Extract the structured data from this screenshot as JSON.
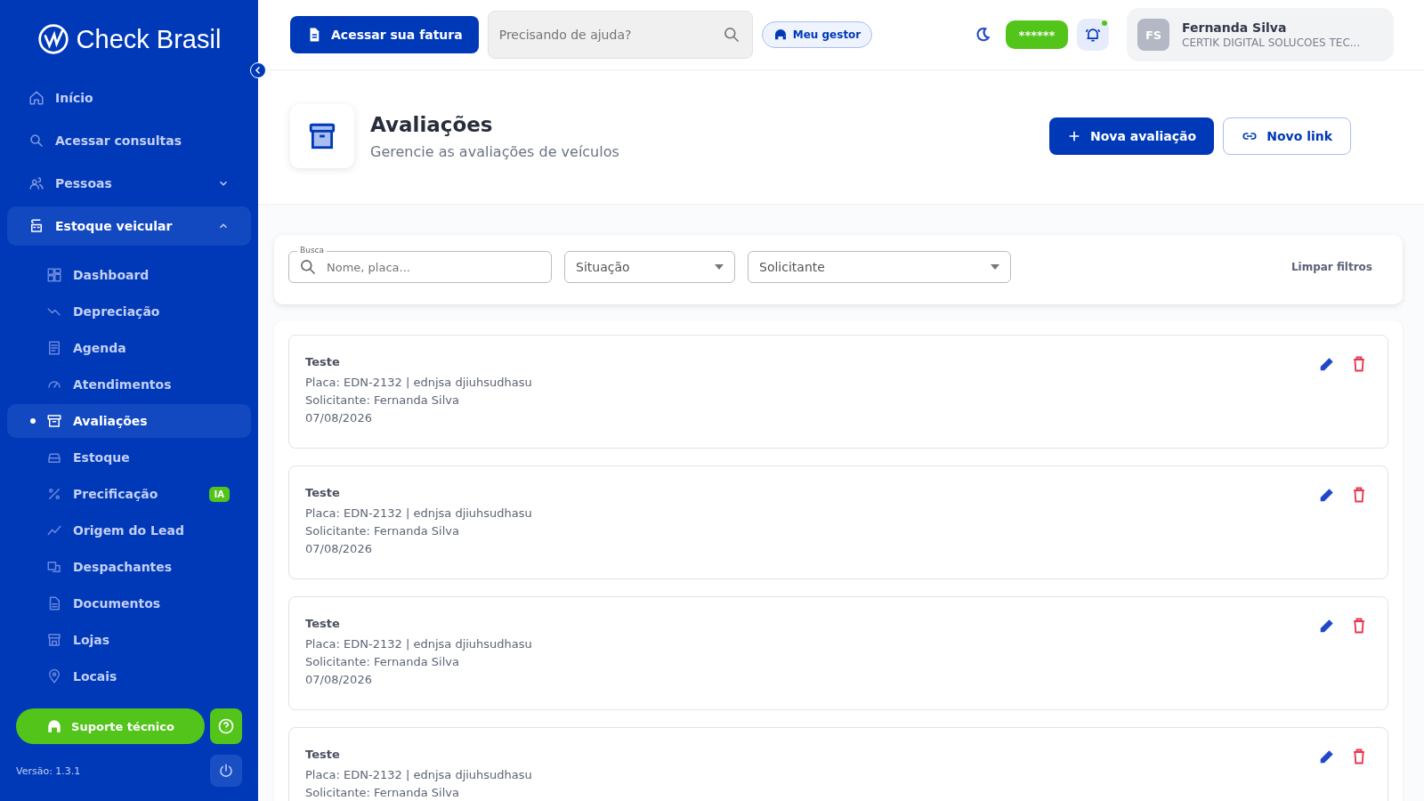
{
  "sidebar": {
    "logo": "Check Brasil",
    "items": [
      {
        "label": "Início",
        "expanded": false
      },
      {
        "label": "Acessar consultas",
        "expanded": false
      },
      {
        "label": "Pessoas",
        "expanded": false,
        "expandable": true
      },
      {
        "label": "Estoque veicular",
        "expanded": true,
        "expandable": true,
        "children": [
          {
            "label": "Dashboard",
            "selected": false
          },
          {
            "label": "Depreciação",
            "selected": false
          },
          {
            "label": "Agenda",
            "selected": false
          },
          {
            "label": "Atendimentos",
            "selected": false
          },
          {
            "label": "Avaliações",
            "selected": true
          },
          {
            "label": "Estoque",
            "selected": false
          },
          {
            "label": "Precificação",
            "selected": false,
            "badge": "IA"
          },
          {
            "label": "Origem do Lead",
            "selected": false
          },
          {
            "label": "Despachantes",
            "selected": false
          },
          {
            "label": "Documentos",
            "selected": false
          },
          {
            "label": "Lojas",
            "selected": false
          },
          {
            "label": "Locais",
            "selected": false
          }
        ]
      }
    ],
    "support_button": "Suporte técnico",
    "version": "Versão: 1.3.1"
  },
  "topbar": {
    "invoice_button": "Acessar sua fatura",
    "search": {
      "placeholder": "Precisando de ajuda?"
    },
    "manager_button": "Meu gestor",
    "masked_badge": "******",
    "notifications_unread": true,
    "user": {
      "initials": "FS",
      "name": "Fernanda Silva",
      "company": "CERTIK DIGITAL SOLUCOES TEC..."
    }
  },
  "page": {
    "title": "Avaliações",
    "subtitle": "Gerencie as avaliações de veículos",
    "buttons": [
      "Nova avaliação",
      "Novo link"
    ]
  },
  "filters": {
    "search": {
      "label": "Busca",
      "placeholder": "Nome, placa..."
    },
    "selects": [
      "Situação",
      "Solicitante"
    ],
    "clear": "Limpar filtros"
  },
  "evaluations": [
    {
      "title": "Teste",
      "plate": "Placa: EDN-2132 | ednjsa djiuhsudhasu",
      "requester": "Solicitante: Fernanda Silva",
      "date": "07/08/2026"
    },
    {
      "title": "Teste",
      "plate": "Placa: EDN-2132 | ednjsa djiuhsudhasu",
      "requester": "Solicitante: Fernanda Silva",
      "date": "07/08/2026"
    },
    {
      "title": "Teste",
      "plate": "Placa: EDN-2132 | ednjsa djiuhsudhasu",
      "requester": "Solicitante: Fernanda Silva",
      "date": "07/08/2026"
    },
    {
      "title": "Teste",
      "plate": "Placa: EDN-2132 | ednjsa djiuhsudhasu",
      "requester": "Solicitante: Fernanda Silva"
    }
  ]
}
